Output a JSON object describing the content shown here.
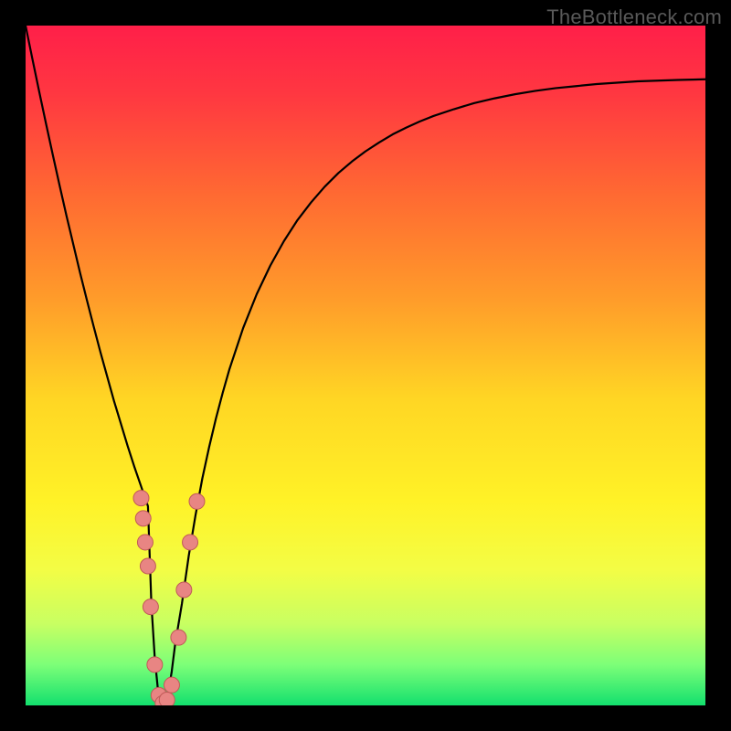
{
  "watermark": "TheBottleneck.com",
  "colors": {
    "frame": "#000000",
    "curve": "#000000",
    "marker_fill": "#e88583",
    "marker_stroke": "#c05a58",
    "gradient_stops": [
      {
        "offset": 0.0,
        "color": "#ff1f49"
      },
      {
        "offset": 0.1,
        "color": "#ff3741"
      },
      {
        "offset": 0.25,
        "color": "#ff6a32"
      },
      {
        "offset": 0.4,
        "color": "#ff9b2a"
      },
      {
        "offset": 0.55,
        "color": "#ffd624"
      },
      {
        "offset": 0.7,
        "color": "#fff227"
      },
      {
        "offset": 0.8,
        "color": "#f3fd45"
      },
      {
        "offset": 0.88,
        "color": "#c8ff62"
      },
      {
        "offset": 0.94,
        "color": "#7dff78"
      },
      {
        "offset": 1.0,
        "color": "#13e06e"
      }
    ]
  },
  "chart_data": {
    "type": "line",
    "title": "",
    "xlabel": "",
    "ylabel": "",
    "xlim": [
      0,
      100
    ],
    "ylim": [
      0,
      100
    ],
    "x": [
      0,
      1,
      2,
      3,
      4,
      5,
      6,
      7,
      8,
      9,
      10,
      11,
      12,
      13,
      14,
      15,
      16,
      17,
      18,
      18.5,
      19,
      19.5,
      20,
      20.5,
      21,
      21.5,
      22,
      23,
      24,
      25,
      26,
      27,
      28,
      29,
      30,
      32,
      34,
      36,
      38,
      40,
      42,
      44,
      46,
      48,
      50,
      52,
      54,
      56,
      58,
      60,
      63,
      66,
      69,
      72,
      75,
      78,
      81,
      84,
      87,
      90,
      93,
      96,
      100
    ],
    "y": [
      100,
      95.1,
      90.3,
      85.6,
      81.0,
      76.5,
      72.1,
      67.9,
      63.7,
      59.7,
      55.8,
      52.0,
      48.4,
      44.8,
      41.5,
      38.2,
      35.1,
      32.2,
      29.3,
      15.0,
      7.0,
      2.0,
      0.0,
      0.5,
      2.0,
      5.0,
      9.0,
      15.0,
      22.0,
      28.0,
      33.4,
      38.0,
      42.2,
      46.0,
      49.5,
      55.5,
      60.5,
      64.7,
      68.3,
      71.4,
      74.0,
      76.3,
      78.3,
      80.0,
      81.5,
      82.8,
      84.0,
      85.0,
      85.9,
      86.7,
      87.7,
      88.6,
      89.3,
      89.9,
      90.4,
      90.8,
      91.1,
      91.4,
      91.6,
      91.8,
      91.9,
      92.0,
      92.1
    ],
    "markers": [
      {
        "x": 17.0,
        "y": 30.5
      },
      {
        "x": 17.3,
        "y": 27.5
      },
      {
        "x": 17.6,
        "y": 24.0
      },
      {
        "x": 18.0,
        "y": 20.5
      },
      {
        "x": 18.4,
        "y": 14.5
      },
      {
        "x": 19.0,
        "y": 6.0
      },
      {
        "x": 19.6,
        "y": 1.5
      },
      {
        "x": 20.2,
        "y": 0.3
      },
      {
        "x": 20.8,
        "y": 0.8
      },
      {
        "x": 21.5,
        "y": 3.0
      },
      {
        "x": 22.5,
        "y": 10.0
      },
      {
        "x": 23.3,
        "y": 17.0
      },
      {
        "x": 24.2,
        "y": 24.0
      },
      {
        "x": 25.2,
        "y": 30.0
      }
    ]
  }
}
